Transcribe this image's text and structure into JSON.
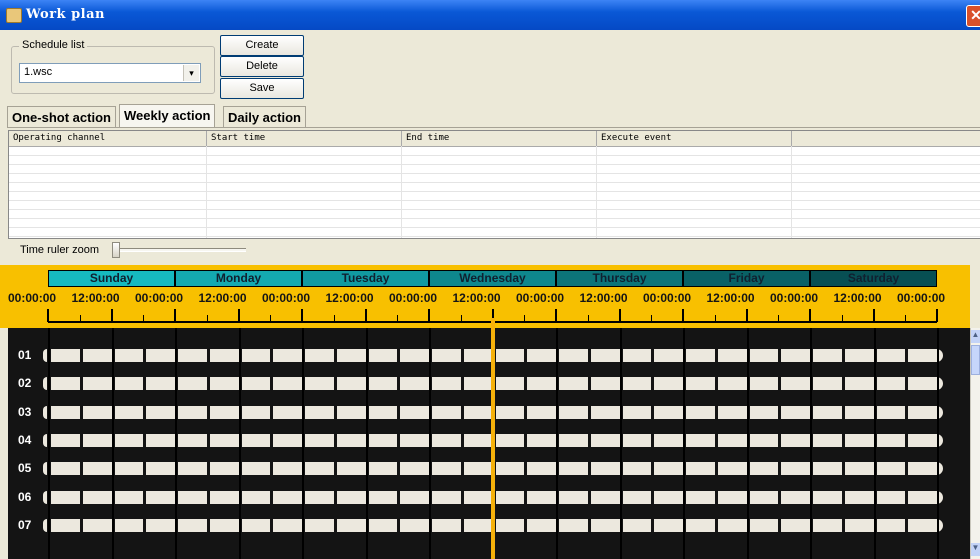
{
  "window": {
    "title": "Work plan",
    "close_glyph": "✕"
  },
  "schedule": {
    "group_label": "Schedule list",
    "selected": "1.wsc",
    "buttons": {
      "create": "Create",
      "delete": "Delete",
      "save": "Save"
    }
  },
  "tabs": [
    {
      "label": "One-shot action",
      "active": false
    },
    {
      "label": "Weekly action",
      "active": true
    },
    {
      "label": "Daily action",
      "active": false
    }
  ],
  "table": {
    "columns": [
      "Operating channel",
      "Start time",
      "End time",
      "Execute event",
      ""
    ]
  },
  "zoom": {
    "label": "Time ruler zoom"
  },
  "timeline": {
    "days": [
      {
        "name": "Sunday",
        "color": "#16b9bf"
      },
      {
        "name": "Monday",
        "color": "#14a9b0"
      },
      {
        "name": "Tuesday",
        "color": "#119aa1"
      },
      {
        "name": "Wednesday",
        "color": "#0e878d"
      },
      {
        "name": "Thursday",
        "color": "#0c7479"
      },
      {
        "name": "Friday",
        "color": "#096166"
      },
      {
        "name": "Saturday",
        "color": "#074f53"
      }
    ],
    "times": [
      "00:00:00",
      "12:00:00",
      "00:00:00",
      "12:00:00",
      "00:00:00",
      "12:00:00",
      "00:00:00",
      "12:00:00",
      "00:00:00",
      "12:00:00",
      "00:00:00",
      "12:00:00",
      "00:00:00",
      "12:00:00",
      "00:00:00"
    ],
    "channels": [
      "01",
      "02",
      "03",
      "04",
      "05",
      "06",
      "07"
    ]
  },
  "colors": {
    "ruler_bg": "#f8c000",
    "grid_bg": "#141414",
    "cursor": "#f6b10a"
  },
  "icons": {
    "dropdown": "▾",
    "scroll_up": "▲",
    "scroll_down": "▼"
  }
}
